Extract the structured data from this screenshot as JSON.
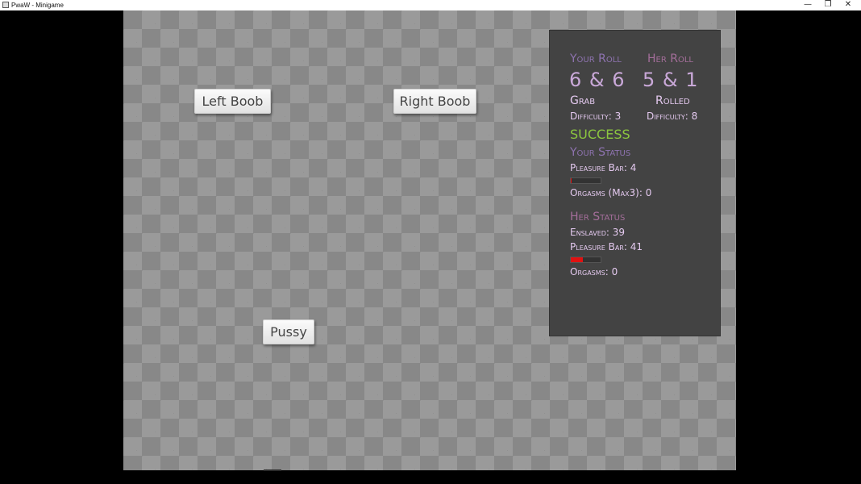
{
  "window": {
    "title": "PwaW - Minigame",
    "minimize_glyph": "—",
    "restore_glyph": "❐",
    "close_glyph": "✕"
  },
  "targets": {
    "left_boob": "Left Boob",
    "right_boob": "Right Boob",
    "pussy": "Pussy"
  },
  "panel": {
    "your_roll_label": "Your Roll",
    "her_roll_label": "Her Roll",
    "your_roll_value": "6 & 6",
    "her_roll_value": "5 & 1",
    "your_action": "Grab",
    "her_action": "Rolled",
    "your_difficulty": "Difficulty: 3",
    "her_difficulty": "Difficulty: 8",
    "result": "SUCCESS",
    "your_status_label": "Your Status",
    "your_pleasure": "Pleasure Bar: 4",
    "your_pleasure_fraction": 0.04,
    "your_orgasms": "Orgasms (Max3): 0",
    "her_status_label": "Her Status",
    "her_enslaved": "Enslaved: 39",
    "her_pleasure": "Pleasure Bar: 41",
    "her_pleasure_fraction": 0.41,
    "her_orgasms": "Orgasms: 0"
  },
  "colors": {
    "success": "#8cc63f",
    "bar_fill": "#e01111",
    "panel_bg": "#434343"
  }
}
